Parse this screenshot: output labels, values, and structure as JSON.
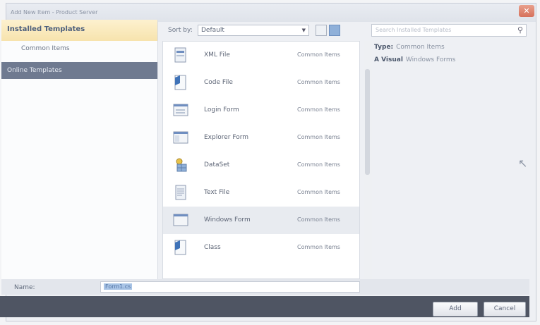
{
  "window": {
    "title": "Add New Item - Product Server"
  },
  "left": {
    "installed_label": "Installed Templates",
    "tree_item": "Common Items",
    "online_label": "Online Templates"
  },
  "toolbar": {
    "sort_label": "Sort by:",
    "sort_value": "Default"
  },
  "search": {
    "placeholder": "Search Installed Templates"
  },
  "items": [
    {
      "name": "XML File",
      "category": "Common Items",
      "icon": "xml-file-icon"
    },
    {
      "name": "Code File",
      "category": "Common Items",
      "icon": "code-file-icon"
    },
    {
      "name": "Login Form",
      "category": "Common Items",
      "icon": "login-form-icon"
    },
    {
      "name": "Explorer Form",
      "category": "Common Items",
      "icon": "explorer-form-icon"
    },
    {
      "name": "DataSet",
      "category": "Common Items",
      "icon": "dataset-icon"
    },
    {
      "name": "Text File",
      "category": "Common Items",
      "icon": "text-file-icon"
    },
    {
      "name": "Windows Form",
      "category": "Common Items",
      "icon": "windows-form-icon"
    },
    {
      "name": "Class",
      "category": "Common Items",
      "icon": "class-icon"
    }
  ],
  "details": {
    "type_label": "Type:",
    "type_value": "Common Items",
    "vb_label": "A Visual",
    "vb_value": "Windows Forms"
  },
  "namebar": {
    "label": "Name:",
    "value": "Form1.cs"
  },
  "footer": {
    "add_label": "Add",
    "cancel_label": "Cancel"
  }
}
